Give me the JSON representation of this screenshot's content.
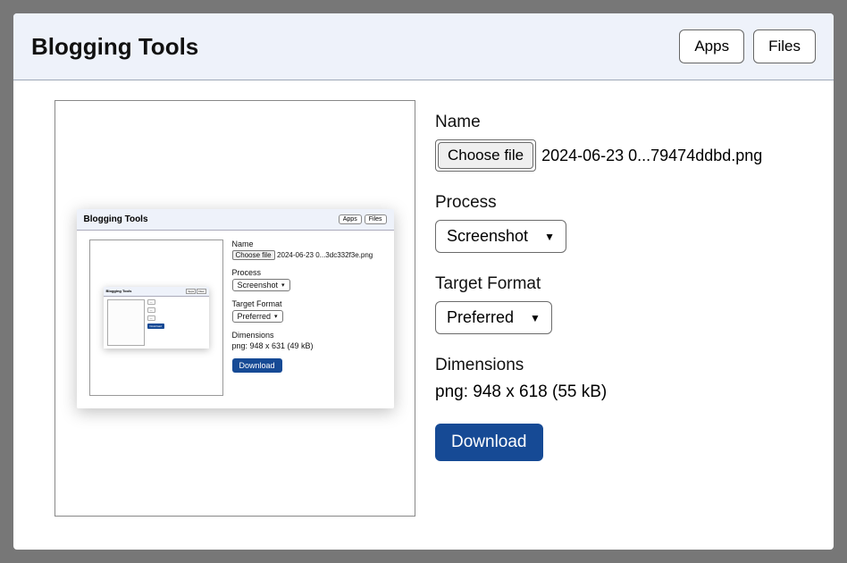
{
  "header": {
    "title": "Blogging Tools",
    "apps_label": "Apps",
    "files_label": "Files"
  },
  "form": {
    "name_label": "Name",
    "choose_file_label": "Choose file",
    "filename": "2024-06-23 0...79474ddbd.png",
    "process_label": "Process",
    "process_value": "Screenshot",
    "format_label": "Target Format",
    "format_value": "Preferred",
    "dimensions_label": "Dimensions",
    "dimensions_value": "png: 948 x 618 (55 kB)",
    "download_label": "Download"
  },
  "preview_l1": {
    "title": "Blogging Tools",
    "apps": "Apps",
    "files": "Files",
    "name_label": "Name",
    "choose": "Choose file",
    "filename": "2024-06-23 0...3dc332f3e.png",
    "process_label": "Process",
    "process_value": "Screenshot",
    "format_label": "Target Format",
    "format_value": "Preferred",
    "dims_label": "Dimensions",
    "dims_value": "png: 948 x 631 (49 kB)",
    "download": "Download"
  },
  "preview_l2": {
    "title": "Blogging Tools",
    "apps": "Apps",
    "files": "Files",
    "download": "Download"
  }
}
